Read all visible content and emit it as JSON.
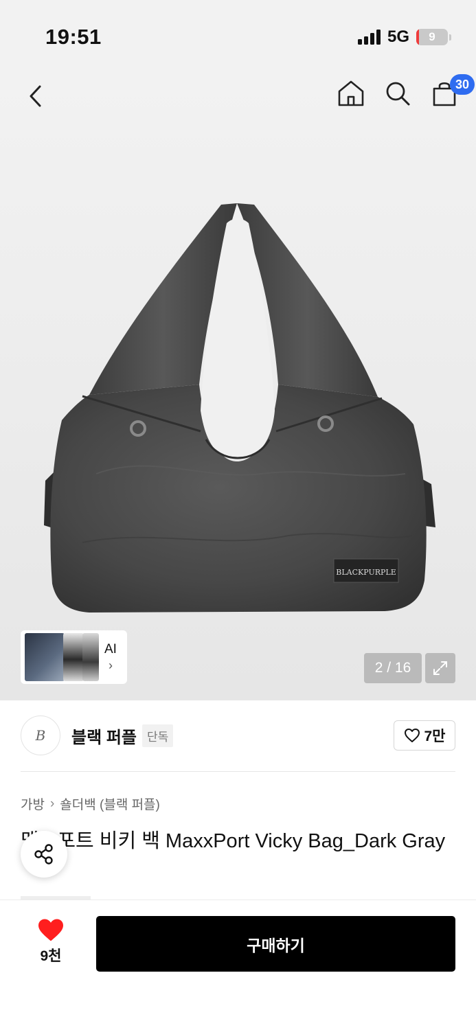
{
  "status_bar": {
    "time": "19:51",
    "network": "5G",
    "battery_percent": "9",
    "battery_level": 0.09,
    "battery_color": "#ef3b3b"
  },
  "nav": {
    "back_icon": "chevron-left-icon",
    "home_icon": "home-icon",
    "search_icon": "search-icon",
    "cart_icon": "shopping-bag-icon",
    "cart_count": "30",
    "badge_color": "#2f6cf0"
  },
  "gallery": {
    "ai_label": "AI",
    "ai_chevron": "›",
    "counter": "2 / 16",
    "expand_icon": "expand-icon",
    "product_logo_text": "BLACKPURPLE"
  },
  "brand": {
    "logo_letter": "B",
    "name": "블랙 퍼플",
    "exclusive_badge": "단독",
    "like_count": "7만"
  },
  "breadcrumb": {
    "items": [
      "가방",
      "숄더백 (블랙 퍼플)"
    ],
    "separator": "›"
  },
  "product": {
    "title": "맥스포트 비키 백 MaxxPort Vicky Bag_Dark Gray"
  },
  "bottom_bar": {
    "wish_count": "9천",
    "buy_label": "구매하기",
    "heart_color": "#ff1e1e"
  }
}
